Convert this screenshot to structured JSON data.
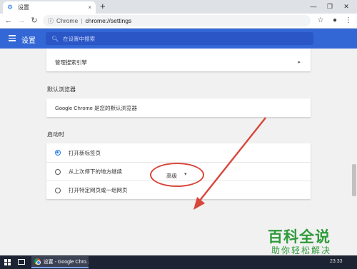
{
  "browser": {
    "tab_title": "设置",
    "tab_close": "×",
    "new_tab": "+",
    "window_minimize": "—",
    "window_restore": "❐",
    "window_close": "✕",
    "address": {
      "site_chip": "Chrome",
      "separator": "|",
      "url": "chrome://settings"
    },
    "icons": {
      "back": "back-icon",
      "forward": "forward-icon",
      "reload": "reload-icon",
      "site_info": "info-icon",
      "bookmark": "star-icon",
      "profile": "profile-icon",
      "menu": "kebab-menu-icon"
    }
  },
  "settings_header": {
    "title": "设置",
    "search_placeholder": "在设置中搜索",
    "accent_color": "#3367d6"
  },
  "sections": {
    "search_engine_row": "管理搜索引擎",
    "default_browser": {
      "label": "默认浏览器",
      "status": "Google Chrome 是您的默认浏览器"
    },
    "startup": {
      "label": "启动时",
      "options": [
        {
          "label": "打开新标签页",
          "checked": true
        },
        {
          "label": "从上次停下的地方继续",
          "checked": false
        },
        {
          "label": "打开特定网页或一组网页",
          "checked": false
        }
      ]
    },
    "advanced": {
      "label": "高级",
      "caret": "▾"
    }
  },
  "annotation": {
    "color": "#d9463a"
  },
  "watermark": {
    "line1": "百科全说",
    "line2": "助你轻松解决"
  },
  "taskbar": {
    "app_label": "设置 - Google Chro...",
    "clock": "23:33"
  }
}
